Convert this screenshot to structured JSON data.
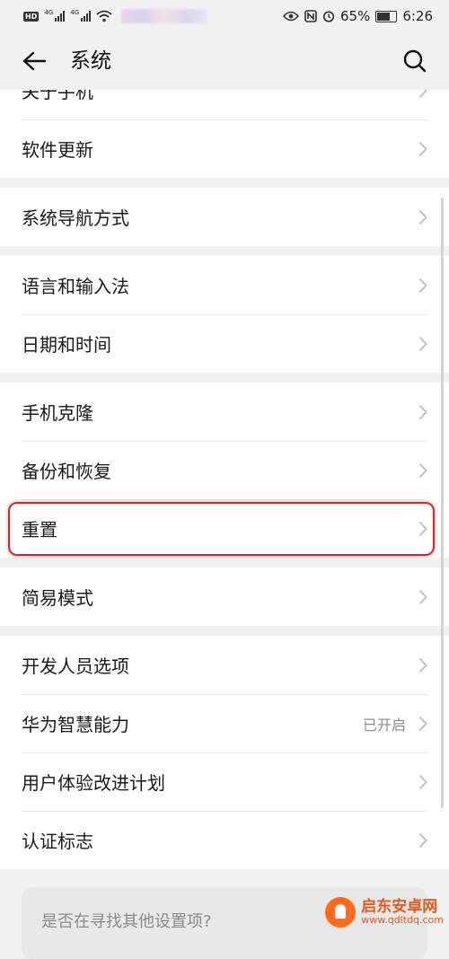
{
  "status_bar": {
    "hd": "HD",
    "net1": "4G",
    "net2": "4G",
    "battery": "65%",
    "time": "6:26"
  },
  "header": {
    "title": "系统"
  },
  "rows": {
    "about": "关于手机",
    "software_update": "软件更新",
    "nav_mode": "系统导航方式",
    "language": "语言和输入法",
    "datetime": "日期和时间",
    "phone_clone": "手机克隆",
    "backup": "备份和恢复",
    "reset": "重置",
    "simple_mode": "简易模式",
    "developer": "开发人员选项",
    "hiai": "华为智慧能力",
    "hiai_value": "已开启",
    "ux_plan": "用户体验改进计划",
    "certification": "认证标志"
  },
  "suggest": {
    "text": "是否在寻找其他设置项?"
  },
  "watermark": {
    "title": "启东安卓网",
    "url": "www.qdltdq.com"
  },
  "icons": [
    "back-arrow-icon",
    "search-icon",
    "chevron-right-icon",
    "wifi-icon",
    "eye-icon",
    "nfc-icon",
    "alarm-icon",
    "battery-icon"
  ],
  "colors": {
    "highlight": "#d4262b",
    "background": "#f1f1f1",
    "watermark": "#e5571b"
  }
}
